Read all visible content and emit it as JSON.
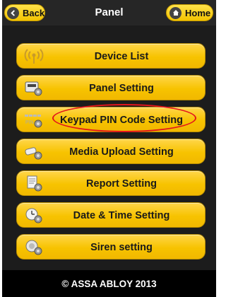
{
  "header": {
    "title": "Panel",
    "back_label": "Back",
    "home_label": "Home"
  },
  "menu": {
    "items": [
      {
        "label": "Device List",
        "icon": "wireless-signal-icon"
      },
      {
        "label": "Panel Setting",
        "icon": "panel-gear-icon"
      },
      {
        "label": "Keypad PIN Code Setting",
        "icon": "keypad-pin-gear-icon"
      },
      {
        "label": "Media Upload Setting",
        "icon": "camera-gear-icon"
      },
      {
        "label": "Report Setting",
        "icon": "document-gear-icon"
      },
      {
        "label": "Date & Time Setting",
        "icon": "clock-gear-icon"
      },
      {
        "label": "Siren setting",
        "icon": "siren-gear-icon"
      }
    ],
    "highlighted_index": 2
  },
  "footer": {
    "copyright": "© ASSA ABLOY 2013"
  },
  "colors": {
    "accent": "#f7c300",
    "highlight_ring": "#e3161c",
    "background": "#1c1c1c"
  }
}
